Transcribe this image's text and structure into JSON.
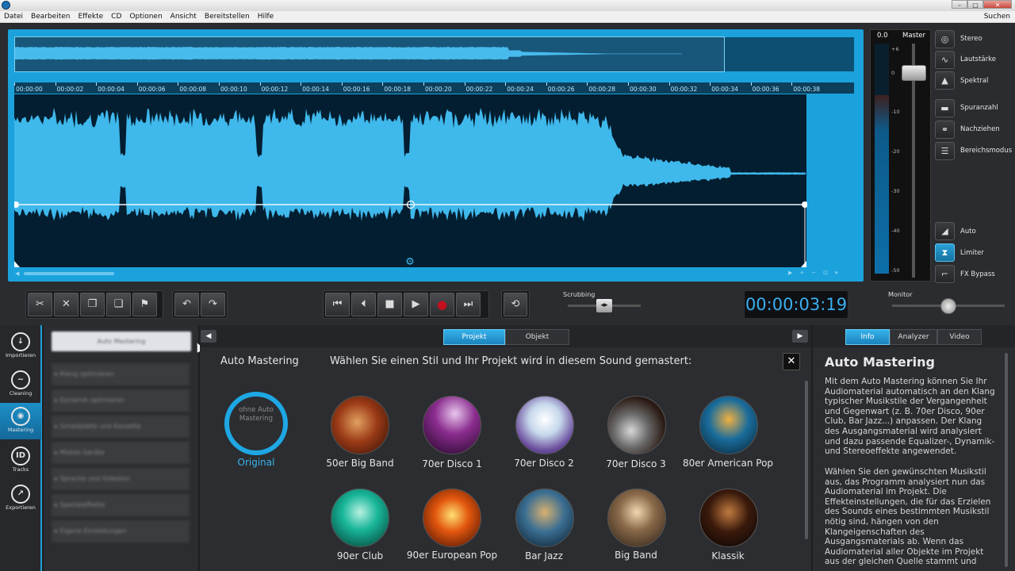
{
  "menu": [
    "Datei",
    "Bearbeiten",
    "Effekte",
    "CD",
    "Optionen",
    "Ansicht",
    "Bereitstellen",
    "Hilfe"
  ],
  "search_label": "Suchen",
  "window_controls": [
    "–",
    "□",
    "✕"
  ],
  "ruler_ticks": [
    "00:00:00",
    "00:00:02",
    "00:00:04",
    "00:00:06",
    "00:00:08",
    "00:00:10",
    "00:00:12",
    "00:00:14",
    "00:00:16",
    "00:00:18",
    "00:00:20",
    "00:00:22",
    "00:00:24",
    "00:00:26",
    "00:00:28",
    "00:00:30",
    "00:00:32",
    "00:00:34",
    "00:00:36",
    "00:00:38"
  ],
  "meter": {
    "db_value": "0.0",
    "title": "Master",
    "scale": [
      "+6",
      "0",
      "-10",
      "-20",
      "-30",
      "-40",
      "-50"
    ]
  },
  "view_tools": [
    {
      "label": "Stereo",
      "icon": "stereo-icon",
      "active": false
    },
    {
      "label": "Lautstärke",
      "icon": "volume-curve-icon",
      "active": false
    },
    {
      "label": "Spektral",
      "icon": "spectrum-icon",
      "active": false
    },
    {
      "label": "Spuranzahl",
      "icon": "track-count-icon",
      "active": false
    },
    {
      "label": "Nachziehen",
      "icon": "link-icon",
      "active": false
    },
    {
      "label": "Bereichsmodus",
      "icon": "range-mode-icon",
      "active": false
    },
    {
      "label": "Auto",
      "icon": "auto-icon",
      "active": false
    },
    {
      "label": "Limiter",
      "icon": "limiter-icon",
      "active": true
    },
    {
      "label": "FX Bypass",
      "icon": "fx-bypass-icon",
      "active": false
    }
  ],
  "scrubbing_label": "Scrubbing",
  "timecode": "00:00:03:19",
  "monitor_label": "Monitor",
  "nav": [
    {
      "label": "Importieren",
      "icon": "import-icon",
      "active": false
    },
    {
      "label": "Cleaning",
      "icon": "cleaning-icon",
      "active": false
    },
    {
      "label": "Mastering",
      "icon": "mastering-icon",
      "active": true
    },
    {
      "label": "Tracks",
      "icon": "tracks-icon",
      "active": false
    },
    {
      "label": "Exportieren",
      "icon": "export-icon",
      "active": false
    }
  ],
  "side_panel": {
    "top": "Auto Mastering",
    "items": [
      "▸ Klang optimieren",
      "▸ Dynamik optimieren",
      "▸ Schallplatte und Kassette",
      "▸ Mobile Geräte",
      "▸ Sprache und Videoton",
      "▸ Spezialeffekte",
      "▸ Eigene Einstellungen"
    ]
  },
  "mid_tabs": [
    "Projekt",
    "Objekt"
  ],
  "auto_mastering": {
    "title": "Auto Mastering",
    "subtitle": "Wählen Sie einen Stil und Ihr Projekt wird in diesem Sound gemastert:",
    "original_inner": "ohne Auto Mastering",
    "original_label": "Original",
    "styles": [
      "50er Big Band",
      "70er Disco 1",
      "70er Disco 2",
      "70er Disco 3",
      "80er American Pop",
      "90er Club",
      "90er European Pop",
      "Bar Jazz",
      "Big Band",
      "Klassik"
    ]
  },
  "info_tabs": [
    "Info",
    "Analyzer",
    "Video"
  ],
  "info": {
    "title": "Auto Mastering",
    "p1": "Mit dem Auto Mastering können Sie Ihr Audiomaterial automatisch an den Klang typischer Musikstile der Vergangenheit und Gegenwart (z. B. 70er Disco, 90er Club, Bar Jazz...) anpassen. Der Klang des Ausgangsmaterial wird analysiert und dazu passende Equalizer-, Dynamik- und Stereoeffekte angewendet.",
    "p2": "Wählen Sie den gewünschten Musikstil aus, das Programm analysiert nun das Audiomaterial im Projekt. Die Effekteinstellungen, die für das Erzielen des Sounds eines bestimmten Musikstil nötig sind, hängen von den Klangeigenschaften des Ausgangsmaterials ab. Wenn das Audiomaterial aller Objekte im Projekt aus der gleichen Quelle stammt und"
  },
  "colors": {
    "accent": "#1ba2dc",
    "waveform": "#3fb8ec",
    "wave_bg": "#031e30",
    "record": "#c2101e",
    "timecode": "#3aaff0"
  }
}
